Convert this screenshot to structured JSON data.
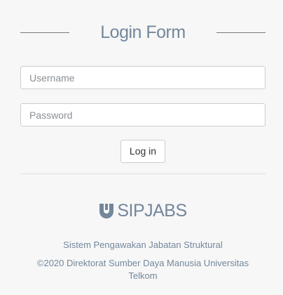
{
  "form": {
    "title": "Login Form",
    "username_placeholder": "Username",
    "password_placeholder": "Password",
    "login_label": "Log in"
  },
  "brand": {
    "name": "SIPJABS",
    "icon": "u-shield-logo-icon",
    "tagline": "Sistem Pengawakan Jabatan Struktural",
    "copyright": "©2020 Direktorat Sumber Daya Manusia Universitas Telkom"
  },
  "colors": {
    "background": "#f7f7f7",
    "text": "#73879c",
    "border": "#cccccc"
  }
}
